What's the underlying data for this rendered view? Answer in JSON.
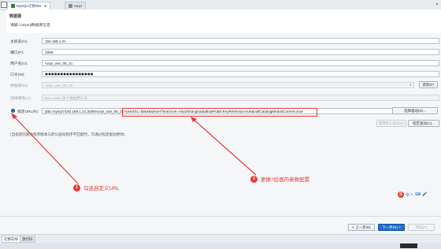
{
  "window": {
    "tabs": [
      {
        "label": "MySQL迁移DM",
        "close": "⊠"
      },
      {
        "label": "ruoyi",
        "close": ""
      }
    ]
  },
  "header": {
    "title": "数据源",
    "description": "请输入Mysql数据库信息"
  },
  "form": {
    "host": {
      "label": "主机名(H):",
      "value": "192.168.1.21"
    },
    "port": {
      "label": "端口(P):",
      "value": "3306"
    },
    "user": {
      "label": "用户名(U):",
      "value": "ruoyi_vue_05_21"
    },
    "password": {
      "label": "口令(W):",
      "value": "●●●●●●●●●●●●●●●●"
    },
    "database": {
      "label": "数据库(M):",
      "value": "ruoyi_vue_05_21",
      "fetch_button": "获取(F)"
    },
    "connection_props": {
      "label": "连接属性(Y):",
      "placeholder": "key=value;多个数据用分号"
    },
    "custom_url": {
      "label": "指定URL(R):",
      "value": "jdbc:mysql://192.168.1.21:3306/ruoyi_vue_05_21?useSSL=false&serverTimezone=Asia/Shanghai&allowPublicKeyRetrieval=true&nullCatalogMeansCurrent=true",
      "select_driver_button": "选择驱动(D)...",
      "default_driver_button": "使用默认驱动(V)",
      "specify_driver_button": "指定驱动(C)..."
    },
    "note": "(当指定的驱动程序版本与默认驱动程序不匹配时，可通过指定驱动更改)"
  },
  "annotations": [
    {
      "num": "1",
      "text": "勾选自定义URL"
    },
    {
      "num": "2",
      "text": "更换?后面的参数配置"
    }
  ],
  "ime": {
    "logo": "S",
    "items": [
      "中",
      "•,",
      "⌨",
      "🎤"
    ]
  },
  "footer": {
    "tabs": [
      "迁移向导",
      "源代码"
    ],
    "back_button": "< 上一步(B)",
    "next_button": "下一步(N) >",
    "finish_button": "完成(F)"
  },
  "colors": {
    "annotation": "#e53935",
    "accent": "#1e6fcf"
  }
}
